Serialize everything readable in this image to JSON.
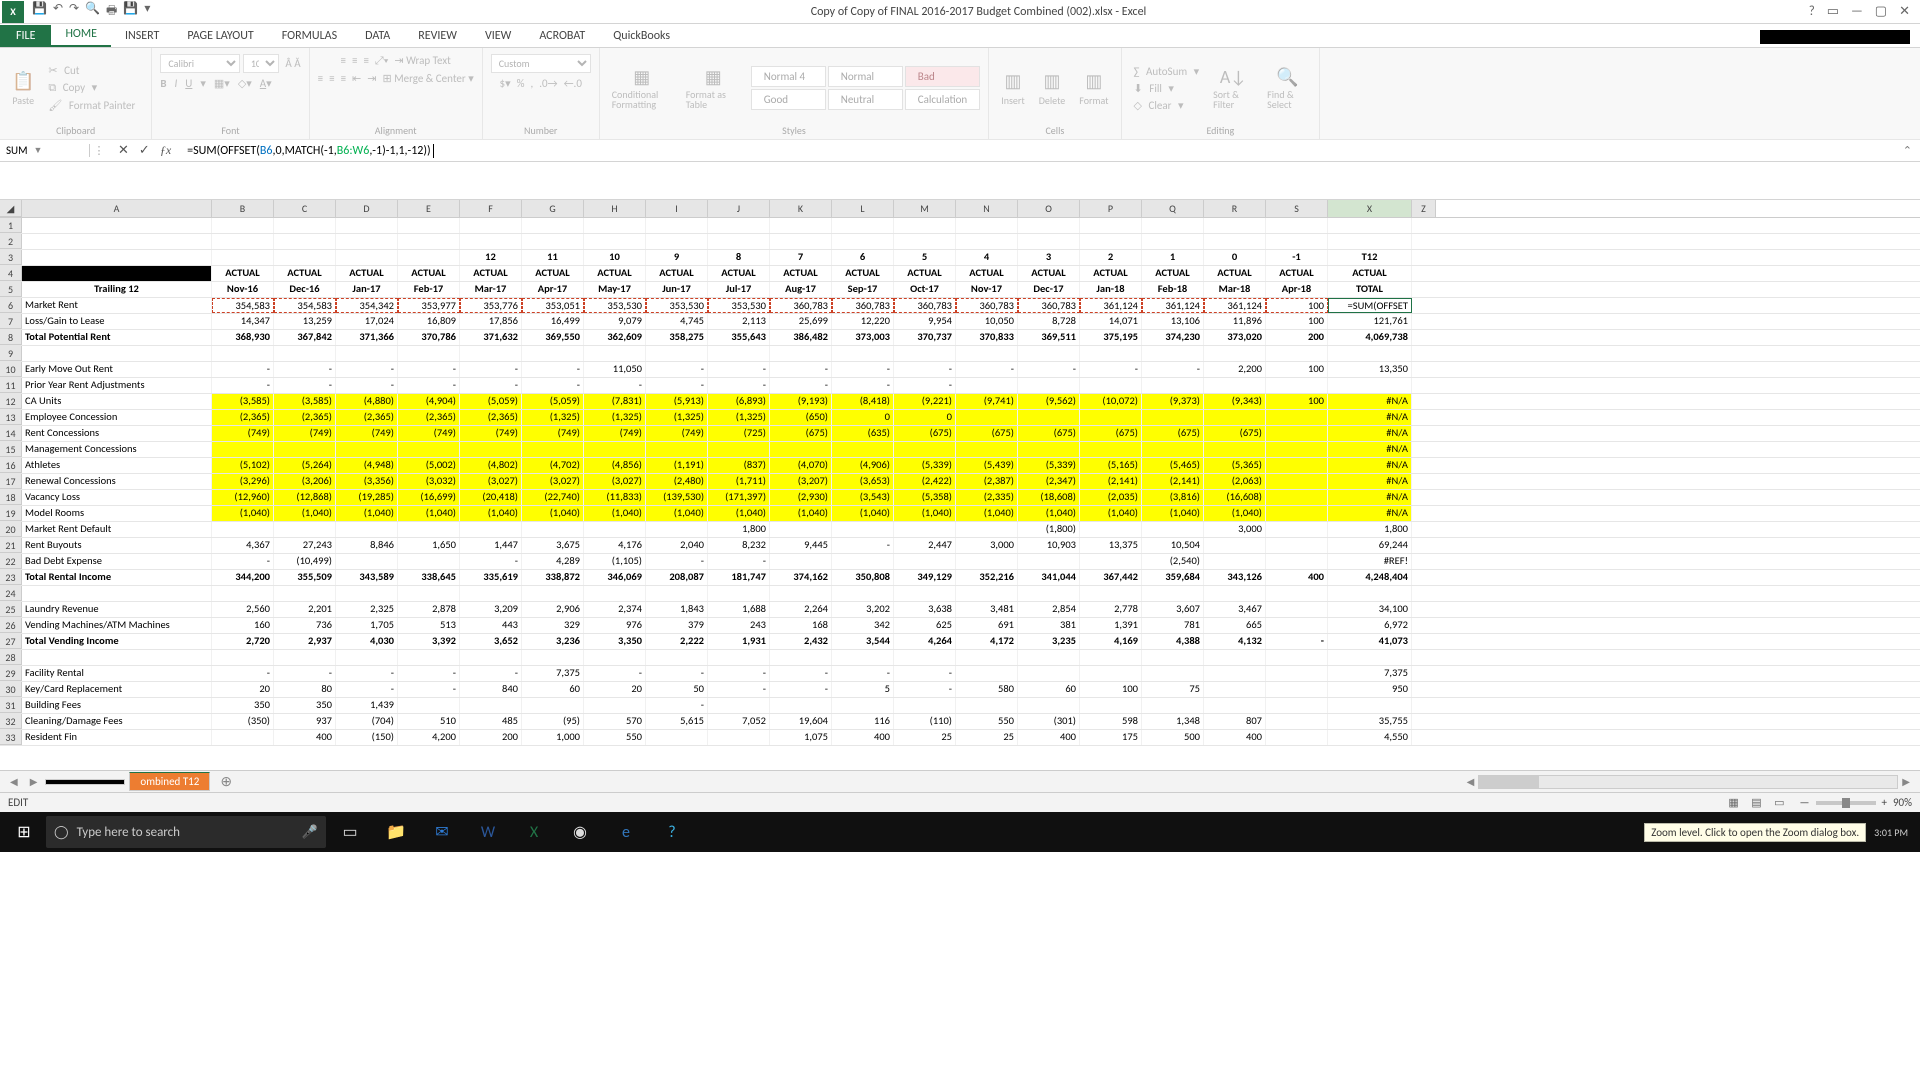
{
  "app": {
    "title": "Copy of Copy of FINAL 2016-2017 Budget Combined (002).xlsx - Excel"
  },
  "ribbon_tabs": [
    "FILE",
    "HOME",
    "INSERT",
    "PAGE LAYOUT",
    "FORMULAS",
    "DATA",
    "REVIEW",
    "VIEW",
    "ACROBAT",
    "QuickBooks"
  ],
  "ribbon": {
    "clipboard": {
      "paste": "Paste",
      "cut": "Cut",
      "copy": "Copy",
      "fmtpainter": "Format Painter",
      "label": "Clipboard"
    },
    "font": {
      "name": "Calibri",
      "size": "10",
      "label": "Font"
    },
    "alignment": {
      "wrap": "Wrap Text",
      "merge": "Merge & Center",
      "label": "Alignment"
    },
    "number": {
      "format": "Custom",
      "label": "Number"
    },
    "styles": {
      "cond": "Conditional Formatting",
      "table": "Format as Table",
      "c1": "Normal 4",
      "c2": "Normal",
      "c3": "Bad",
      "c4": "Good",
      "c5": "Neutral",
      "c6": "Calculation",
      "label": "Styles"
    },
    "cells": {
      "ins": "Insert",
      "del": "Delete",
      "fmt": "Format",
      "label": "Cells"
    },
    "editing": {
      "autosum": "AutoSum",
      "fill": "Fill",
      "clear": "Clear",
      "sort": "Sort & Filter",
      "find": "Find & Select",
      "label": "Editing"
    }
  },
  "namebox": "SUM",
  "formula": {
    "raw": "=SUM(OFFSET(B6,0,MATCH(-1,B6:W6,-1)-1,1,-12))",
    "ref1": "B6",
    "ref2": "B6:W6"
  },
  "cols": {
    "letters": [
      "A",
      "B",
      "C",
      "D",
      "E",
      "F",
      "G",
      "H",
      "I",
      "J",
      "K",
      "L",
      "M",
      "N",
      "O",
      "P",
      "Q",
      "R",
      "S",
      "X"
    ],
    "widths": [
      190,
      62,
      62,
      62,
      62,
      62,
      62,
      62,
      62,
      62,
      62,
      62,
      62,
      62,
      62,
      62,
      62,
      62,
      62,
      84
    ],
    "a_width": 190
  },
  "row3": [
    "",
    "",
    "",
    "",
    "",
    "12",
    "11",
    "10",
    "9",
    "8",
    "7",
    "6",
    "5",
    "4",
    "3",
    "2",
    "1",
    "0",
    "-1",
    "T12"
  ],
  "row4": [
    "",
    "ACTUAL",
    "ACTUAL",
    "ACTUAL",
    "ACTUAL",
    "ACTUAL",
    "ACTUAL",
    "ACTUAL",
    "ACTUAL",
    "ACTUAL",
    "ACTUAL",
    "ACTUAL",
    "ACTUAL",
    "ACTUAL",
    "ACTUAL",
    "ACTUAL",
    "ACTUAL",
    "ACTUAL",
    "ACTUAL",
    "ACTUAL"
  ],
  "row5": [
    "Trailing 12",
    "Nov-16",
    "Dec-16",
    "Jan-17",
    "Feb-17",
    "Mar-17",
    "Apr-17",
    "May-17",
    "Jun-17",
    "Jul-17",
    "Aug-17",
    "Sep-17",
    "Oct-17",
    "Nov-17",
    "Dec-17",
    "Jan-18",
    "Feb-18",
    "Mar-18",
    "Apr-18",
    "TOTAL"
  ],
  "data_rows": [
    {
      "n": 6,
      "lab": "Market Rent",
      "v": [
        "354,583",
        "354,583",
        "354,342",
        "353,977",
        "353,776",
        "353,051",
        "353,530",
        "353,530",
        "353,530",
        "360,783",
        "360,783",
        "360,783",
        "360,783",
        "360,783",
        "361,124",
        "361,124",
        "361,124",
        "100",
        "=SUM(OFFSET"
      ],
      "dashred": true,
      "active": true
    },
    {
      "n": 7,
      "lab": "Loss/Gain to Lease",
      "v": [
        "14,347",
        "13,259",
        "17,024",
        "16,809",
        "17,856",
        "16,499",
        "9,079",
        "4,745",
        "2,113",
        "25,699",
        "12,220",
        "9,954",
        "10,050",
        "8,728",
        "14,071",
        "13,106",
        "11,896",
        "100",
        "121,761"
      ]
    },
    {
      "n": 8,
      "lab": "Total Potential Rent",
      "bold": true,
      "v": [
        "368,930",
        "367,842",
        "371,366",
        "370,786",
        "371,632",
        "369,550",
        "362,609",
        "358,275",
        "355,643",
        "386,482",
        "373,003",
        "370,737",
        "370,833",
        "369,511",
        "375,195",
        "374,230",
        "373,020",
        "200",
        "4,069,738"
      ]
    },
    {
      "n": 9,
      "lab": "",
      "v": [
        "",
        "",
        "",
        "",
        "",
        "",
        "",
        "",
        "",
        "",
        "",
        "",
        "",
        "",
        "",
        "",
        "",
        "",
        ""
      ]
    },
    {
      "n": 10,
      "lab": "Early Move Out Rent",
      "v": [
        "-",
        "-",
        "-",
        "-",
        "-",
        "-",
        "11,050",
        "-",
        "-",
        "-",
        "-",
        "-",
        "-",
        "-",
        "-",
        "-",
        "2,200",
        "100",
        "13,350"
      ]
    },
    {
      "n": 11,
      "lab": "Prior Year Rent Adjustments",
      "v": [
        "-",
        "-",
        "-",
        "-",
        "-",
        "-",
        "-",
        "-",
        "-",
        "-",
        "-",
        "-",
        "",
        "",
        "",
        "",
        "",
        "",
        ""
      ]
    },
    {
      "n": 12,
      "lab": "CA Units",
      "yellow": true,
      "v": [
        "(3,585)",
        "(3,585)",
        "(4,880)",
        "(4,904)",
        "(5,059)",
        "(5,059)",
        "(7,831)",
        "(5,913)",
        "(6,893)",
        "(9,193)",
        "(8,418)",
        "(9,221)",
        "(9,741)",
        "(9,562)",
        "(10,072)",
        "(9,373)",
        "(9,343)",
        "100",
        "#N/A"
      ]
    },
    {
      "n": 13,
      "lab": "Employee Concession",
      "yellow": true,
      "v": [
        "(2,365)",
        "(2,365)",
        "(2,365)",
        "(2,365)",
        "(2,365)",
        "(1,325)",
        "(1,325)",
        "(1,325)",
        "(1,325)",
        "(650)",
        "0",
        "0",
        "",
        "",
        "",
        "",
        "",
        "",
        "#N/A"
      ]
    },
    {
      "n": 14,
      "lab": "Rent Concessions",
      "yellow": true,
      "v": [
        "(749)",
        "(749)",
        "(749)",
        "(749)",
        "(749)",
        "(749)",
        "(749)",
        "(749)",
        "(725)",
        "(675)",
        "(635)",
        "(675)",
        "(675)",
        "(675)",
        "(675)",
        "(675)",
        "(675)",
        "",
        "#N/A"
      ]
    },
    {
      "n": 15,
      "lab": "Management Concessions",
      "yellow": true,
      "v": [
        "",
        "",
        "",
        "",
        "",
        "",
        "",
        "",
        "",
        "",
        "",
        "",
        "",
        "",
        "",
        "",
        "",
        "",
        "#N/A"
      ]
    },
    {
      "n": 16,
      "lab": "Athletes",
      "yellow": true,
      "v": [
        "(5,102)",
        "(5,264)",
        "(4,948)",
        "(5,002)",
        "(4,802)",
        "(4,702)",
        "(4,856)",
        "(1,191)",
        "(837)",
        "(4,070)",
        "(4,906)",
        "(5,339)",
        "(5,439)",
        "(5,339)",
        "(5,165)",
        "(5,465)",
        "(5,365)",
        "",
        "#N/A"
      ]
    },
    {
      "n": 17,
      "lab": "Renewal Concessions",
      "yellow": true,
      "v": [
        "(3,296)",
        "(3,206)",
        "(3,356)",
        "(3,032)",
        "(3,027)",
        "(3,027)",
        "(3,027)",
        "(2,480)",
        "(1,711)",
        "(3,207)",
        "(3,653)",
        "(2,422)",
        "(2,387)",
        "(2,347)",
        "(2,141)",
        "(2,141)",
        "(2,063)",
        "",
        "#N/A"
      ]
    },
    {
      "n": 18,
      "lab": "Vacancy Loss",
      "yellow": true,
      "v": [
        "(12,960)",
        "(12,868)",
        "(19,285)",
        "(16,699)",
        "(20,418)",
        "(22,740)",
        "(11,833)",
        "(139,530)",
        "(171,397)",
        "(2,930)",
        "(3,543)",
        "(5,358)",
        "(2,335)",
        "(18,608)",
        "(2,035)",
        "(3,816)",
        "(16,608)",
        "",
        "#N/A"
      ]
    },
    {
      "n": 19,
      "lab": "Model Rooms",
      "yellow": true,
      "v": [
        "(1,040)",
        "(1,040)",
        "(1,040)",
        "(1,040)",
        "(1,040)",
        "(1,040)",
        "(1,040)",
        "(1,040)",
        "(1,040)",
        "(1,040)",
        "(1,040)",
        "(1,040)",
        "(1,040)",
        "(1,040)",
        "(1,040)",
        "(1,040)",
        "(1,040)",
        "",
        "#N/A"
      ]
    },
    {
      "n": 20,
      "lab": "Market Rent Default",
      "v": [
        "",
        "",
        "",
        "",
        "",
        "",
        "",
        "",
        "1,800",
        "",
        "",
        "",
        "",
        "(1,800)",
        "",
        "",
        "3,000",
        "",
        "1,800"
      ]
    },
    {
      "n": 21,
      "lab": "Rent Buyouts",
      "v": [
        "4,367",
        "27,243",
        "8,846",
        "1,650",
        "1,447",
        "3,675",
        "4,176",
        "2,040",
        "8,232",
        "9,445",
        "-",
        "2,447",
        "3,000",
        "10,903",
        "13,375",
        "10,504",
        "",
        "",
        "69,244"
      ]
    },
    {
      "n": 22,
      "lab": "Bad Debt Expense",
      "v": [
        "-",
        "(10,499)",
        "",
        "",
        "-",
        "4,289",
        "(1,105)",
        "-",
        "-",
        "",
        "",
        "",
        "",
        "",
        "",
        "(2,540)",
        "",
        "",
        "#REF!"
      ]
    },
    {
      "n": 23,
      "lab": "Total Rental Income",
      "bold": true,
      "v": [
        "344,200",
        "355,509",
        "343,589",
        "338,645",
        "335,619",
        "338,872",
        "346,069",
        "208,087",
        "181,747",
        "374,162",
        "350,808",
        "349,129",
        "352,216",
        "341,044",
        "367,442",
        "359,684",
        "343,126",
        "400",
        "4,248,404"
      ]
    },
    {
      "n": 24,
      "lab": "",
      "v": [
        "",
        "",
        "",
        "",
        "",
        "",
        "",
        "",
        "",
        "",
        "",
        "",
        "",
        "",
        "",
        "",
        "",
        "",
        ""
      ]
    },
    {
      "n": 25,
      "lab": "Laundry Revenue",
      "v": [
        "2,560",
        "2,201",
        "2,325",
        "2,878",
        "3,209",
        "2,906",
        "2,374",
        "1,843",
        "1,688",
        "2,264",
        "3,202",
        "3,638",
        "3,481",
        "2,854",
        "2,778",
        "3,607",
        "3,467",
        "",
        "34,100"
      ]
    },
    {
      "n": 26,
      "lab": "Vending Machines/ATM Machines",
      "v": [
        "160",
        "736",
        "1,705",
        "513",
        "443",
        "329",
        "976",
        "379",
        "243",
        "168",
        "342",
        "625",
        "691",
        "381",
        "1,391",
        "781",
        "665",
        "",
        "6,972"
      ]
    },
    {
      "n": 27,
      "lab": "Total Vending Income",
      "bold": true,
      "v": [
        "2,720",
        "2,937",
        "4,030",
        "3,392",
        "3,652",
        "3,236",
        "3,350",
        "2,222",
        "1,931",
        "2,432",
        "3,544",
        "4,264",
        "4,172",
        "3,235",
        "4,169",
        "4,388",
        "4,132",
        "-",
        "41,073"
      ]
    },
    {
      "n": 28,
      "lab": "",
      "v": [
        "",
        "",
        "",
        "",
        "",
        "",
        "",
        "",
        "",
        "",
        "",
        "",
        "",
        "",
        "",
        "",
        "",
        "",
        ""
      ]
    },
    {
      "n": 29,
      "lab": "Facility Rental",
      "v": [
        "-",
        "-",
        "-",
        "-",
        "-",
        "7,375",
        "-",
        "-",
        "-",
        "-",
        "-",
        "-",
        "",
        "",
        "",
        "",
        "",
        "",
        "7,375"
      ]
    },
    {
      "n": 30,
      "lab": "Key/Card Replacement",
      "v": [
        "20",
        "80",
        "-",
        "-",
        "840",
        "60",
        "20",
        "50",
        "-",
        "-",
        "5",
        "-",
        "580",
        "60",
        "100",
        "75",
        "",
        "",
        "950"
      ]
    },
    {
      "n": 31,
      "lab": "Building Fees",
      "v": [
        "350",
        "350",
        "1,439",
        "",
        "",
        "",
        "",
        "-",
        "",
        "",
        "",
        "",
        "",
        "",
        "",
        "",
        "",
        "",
        ""
      ]
    },
    {
      "n": 32,
      "lab": "Cleaning/Damage Fees",
      "v": [
        "(350)",
        "937",
        "(704)",
        "510",
        "485",
        "(95)",
        "570",
        "5,615",
        "7,052",
        "19,604",
        "116",
        "(110)",
        "550",
        "(301)",
        "598",
        "1,348",
        "807",
        "",
        "35,755"
      ]
    },
    {
      "n": 33,
      "lab": "Resident Fin",
      "cut": true,
      "v": [
        "",
        "400",
        "(150)",
        "4,200",
        "200",
        "1,000",
        "550",
        "",
        "",
        "1,075",
        "400",
        "25",
        "25",
        "400",
        "175",
        "500",
        "400",
        "",
        "4,550"
      ]
    }
  ],
  "sheettab_active": "ombined T12",
  "status": {
    "mode": "EDIT",
    "zoom": "90%",
    "tip": "Zoom level. Click to open the Zoom dialog box."
  },
  "taskbar": {
    "search_placeholder": "Type here to search",
    "time": "3:01 PM"
  }
}
